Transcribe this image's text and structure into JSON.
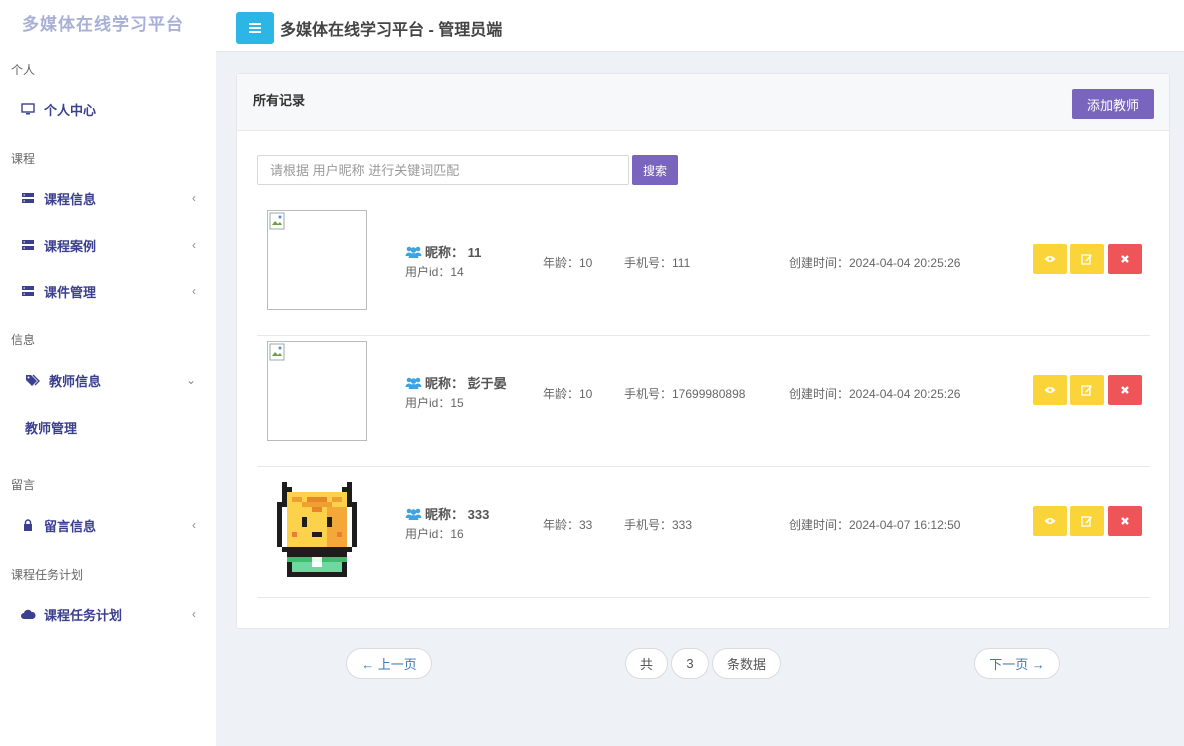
{
  "sidebar": {
    "logo": "多媒体在线学习平台",
    "sections": {
      "personal": "个人",
      "course": "课程",
      "info": "信息",
      "message": "留言",
      "plan": "课程任务计划"
    },
    "items": {
      "personal_center": "个人中心",
      "course_info": "课程信息",
      "course_case": "课程案例",
      "courseware": "课件管理",
      "teacher_info": "教师信息",
      "teacher_manage": "教师管理",
      "message_info": "留言信息",
      "course_plan": "课程任务计划"
    }
  },
  "header": {
    "title": "多媒体在线学习平台 - 管理员端"
  },
  "card": {
    "title": "所有记录",
    "add_button": "添加教师",
    "search_placeholder": "请根据 用户昵称 进行关键词匹配",
    "search_button": "搜索"
  },
  "rows": [
    {
      "nickname": "昵称： 11",
      "user_id": "用户id：14",
      "age": "年龄：10",
      "phone": "手机号：111",
      "created": "创建时间：2024-04-04 20:25:26",
      "avatar": "broken-image"
    },
    {
      "nickname": "昵称： 彭于晏",
      "user_id": "用户id：15",
      "age": "年龄：10",
      "phone": "手机号：17699980898",
      "created": "创建时间：2024-04-04 20:25:26",
      "avatar": "broken-image"
    },
    {
      "nickname": "昵称： 333",
      "user_id": "用户id：16",
      "age": "年龄：33",
      "phone": "手机号：333",
      "created": "创建时间：2024-04-07 16:12:50",
      "avatar": "pixel-cat"
    }
  ],
  "pagination": {
    "prev": "← 上一页",
    "total_prefix": "共",
    "total": "3",
    "total_suffix": "条数据",
    "next": "下一页 →"
  },
  "colors": {
    "accent": "#7a65be",
    "menu": "#2cb6e6",
    "view_edit": "#fbd43a",
    "delete": "#ef5558"
  }
}
